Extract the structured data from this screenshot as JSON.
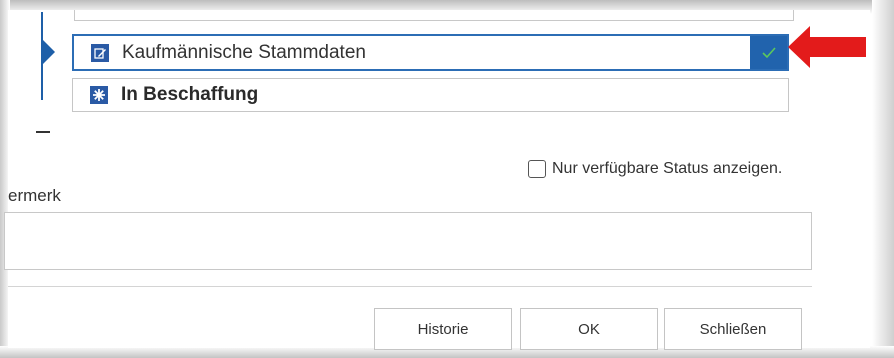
{
  "status_list": {
    "items": [
      {
        "label": "Kaufmännische Stammdaten",
        "icon": "edit-document-icon",
        "selected": true
      },
      {
        "label": "In Beschaffung",
        "icon": "asterisk-icon",
        "selected": false
      }
    ],
    "selected_indicator_icon": "checkmark-icon"
  },
  "filter": {
    "label": "Nur verfügbare Status anzeigen.",
    "checked": false
  },
  "remark": {
    "label": "ermerk",
    "value": ""
  },
  "buttons": {
    "history": "Historie",
    "ok": "OK",
    "close": "Schließen"
  },
  "colors": {
    "accent": "#2163ad",
    "pointer_arrow": "#e31b1b"
  }
}
